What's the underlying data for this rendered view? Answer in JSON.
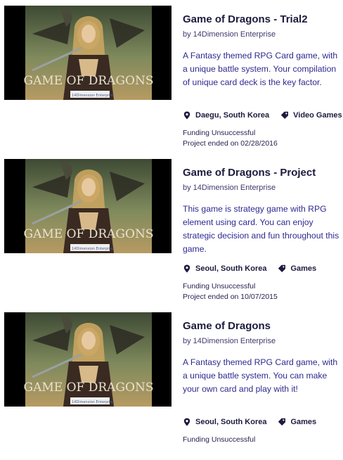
{
  "projects": [
    {
      "title": "Game of Dragons - Trial2",
      "creator": "by 14Dimension Enterprise",
      "blurb": "A Fantasy themed RPG Card game, with a unique battle system. Your compilation of unique card deck is the key factor.",
      "location": "Daegu, South Korea",
      "category": "Video Games",
      "status": "Funding Unsuccessful",
      "ended": "Project ended on 02/28/2016",
      "image_text": "GAME OF DRAGONS",
      "image_badge": "14Dimension Enterprise"
    },
    {
      "title": "Game of Dragons - Project",
      "creator": "by 14Dimension Enterprise",
      "blurb": "This game is strategy game with RPG element using card. You can enjoy strategic decision and fun throughout this game.",
      "location": "Seoul, South Korea",
      "category": "Games",
      "status": "Funding Unsuccessful",
      "ended": "Project ended on 10/07/2015",
      "image_text": "GAME OF DRAGONS",
      "image_badge": "14Dimension Enterprise"
    },
    {
      "title": "Game of Dragons",
      "creator": "by 14Dimension Enterprise",
      "blurb": "A Fantasy themed RPG Card game, with a unique battle system. You can make your own card and play with it!",
      "location": "Seoul, South Korea",
      "category": "Games",
      "status": "Funding Unsuccessful",
      "ended": "",
      "image_text": "GAME OF DRAGONS",
      "image_badge": "14Dimension Enterprise"
    }
  ],
  "colors": {
    "title": "#1c1b3e",
    "blurb": "#2d2a8f",
    "sky": "#6f7f5a",
    "gold": "#c9a560"
  },
  "icons": {
    "location": "map-pin-icon",
    "category": "tag-icon"
  }
}
